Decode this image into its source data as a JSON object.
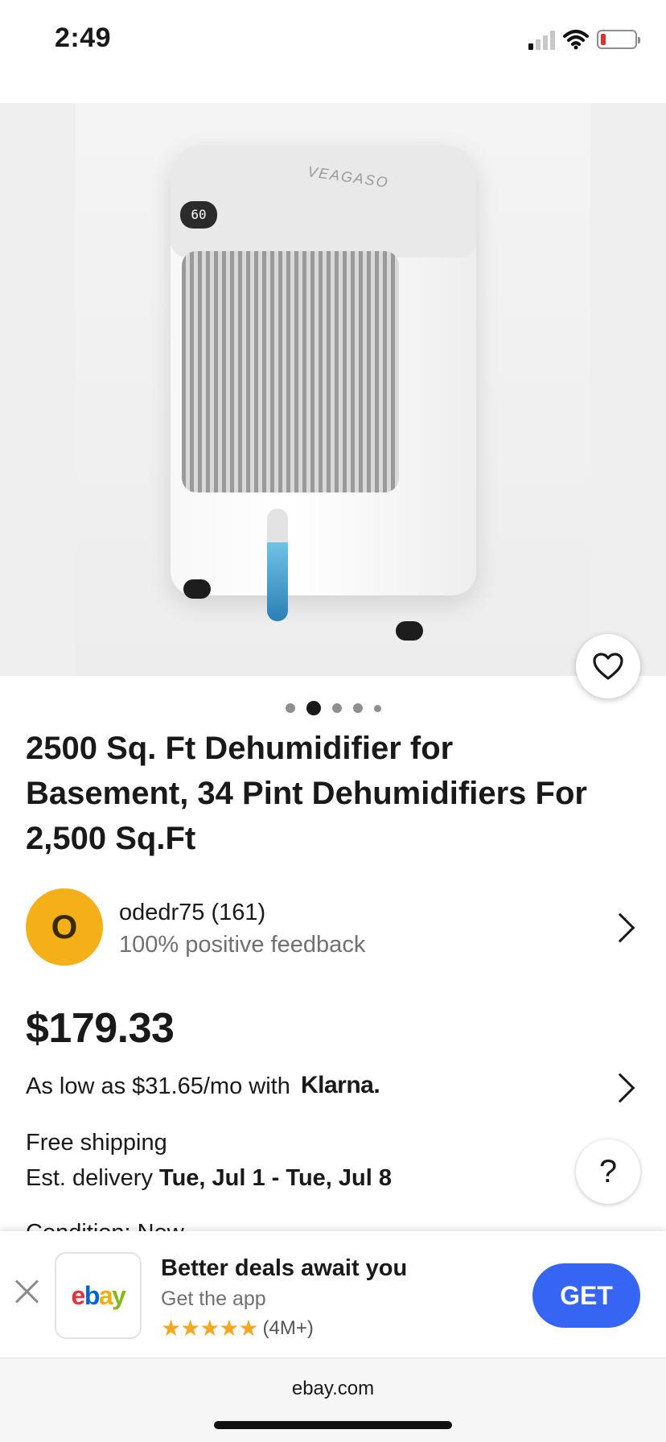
{
  "status_bar": {
    "time": "2:49"
  },
  "product": {
    "image_brand": "VEAGASO",
    "image_display": "60",
    "image_count": 5,
    "active_image": 2,
    "title": "2500 Sq. Ft Dehumidifier for Basement, 34 Pint Dehumidifiers For 2,500 Sq.Ft",
    "price": "$179.33"
  },
  "seller": {
    "avatar_letter": "O",
    "name": "odedr75 (161)",
    "feedback": "100% positive feedback"
  },
  "financing": {
    "text": "As low as $31.65/mo with",
    "provider": "Klarna."
  },
  "shipping": {
    "label": "Free shipping",
    "est_prefix": "Est. delivery",
    "est_range": "Tue, Jul 1 - Tue, Jul 8"
  },
  "condition_peek": "Condition: New",
  "help_label": "?",
  "app_banner": {
    "title": "Better deals await you",
    "subtitle": "Get the app",
    "stars": "★★★★★",
    "rating_count": "(4M+)",
    "get_label": "GET",
    "logo_letters": [
      "e",
      "b",
      "a",
      "y"
    ]
  },
  "browser": {
    "url": "ebay.com"
  },
  "colors": {
    "get_button": "#3665f3",
    "avatar": "#f5af19",
    "star": "#f5a623",
    "ebay_e": "#e53238",
    "ebay_b": "#0064d2",
    "ebay_a": "#f5af02",
    "ebay_y": "#86b817"
  }
}
